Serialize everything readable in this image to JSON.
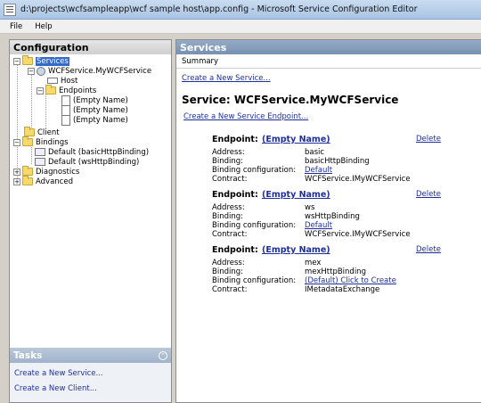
{
  "window": {
    "title": "d:\\projects\\wcfsampleapp\\wcf sample host\\app.config - Microsoft Service Configuration Editor"
  },
  "menu": [
    "File",
    "Help"
  ],
  "config_panel": {
    "header": "Configuration",
    "tree": {
      "services": "Services",
      "service": "WCFService.MyWCFService",
      "host": "Host",
      "endpoints": "Endpoints",
      "endpoint_items": [
        "(Empty Name)",
        "(Empty Name)",
        "(Empty Name)"
      ],
      "client": "Client",
      "bindings": "Bindings",
      "binding_items": [
        "Default (basicHttpBinding)",
        "Default (wsHttpBinding)"
      ],
      "diagnostics": "Diagnostics",
      "advanced": "Advanced"
    }
  },
  "tasks": {
    "header": "Tasks",
    "links": [
      "Create a New Service...",
      "Create a New Client..."
    ]
  },
  "services_panel": {
    "header": "Services",
    "tab": "Summary",
    "create_service": "Create a New Service...",
    "service_title": "Service: WCFService.MyWCFService",
    "create_endpoint": "Create a New Service Endpoint...",
    "labels": {
      "endpoint": "Endpoint:",
      "address": "Address:",
      "binding": "Binding:",
      "binding_config": "Binding configuration:",
      "contract": "Contract:",
      "delete": "Delete"
    },
    "endpoints": [
      {
        "name": "(Empty Name)",
        "address": "basic",
        "binding": "basicHttpBinding",
        "binding_config": "Default",
        "contract": "WCFService.IMyWCFService"
      },
      {
        "name": "(Empty Name)",
        "address": "ws",
        "binding": "wsHttpBinding",
        "binding_config": "Default",
        "contract": "WCFService.IMyWCFService"
      },
      {
        "name": "(Empty Name)",
        "address": "mex",
        "binding": "mexHttpBinding",
        "binding_config": "(Default) Click to Create",
        "contract": "IMetadataExchange"
      }
    ]
  }
}
